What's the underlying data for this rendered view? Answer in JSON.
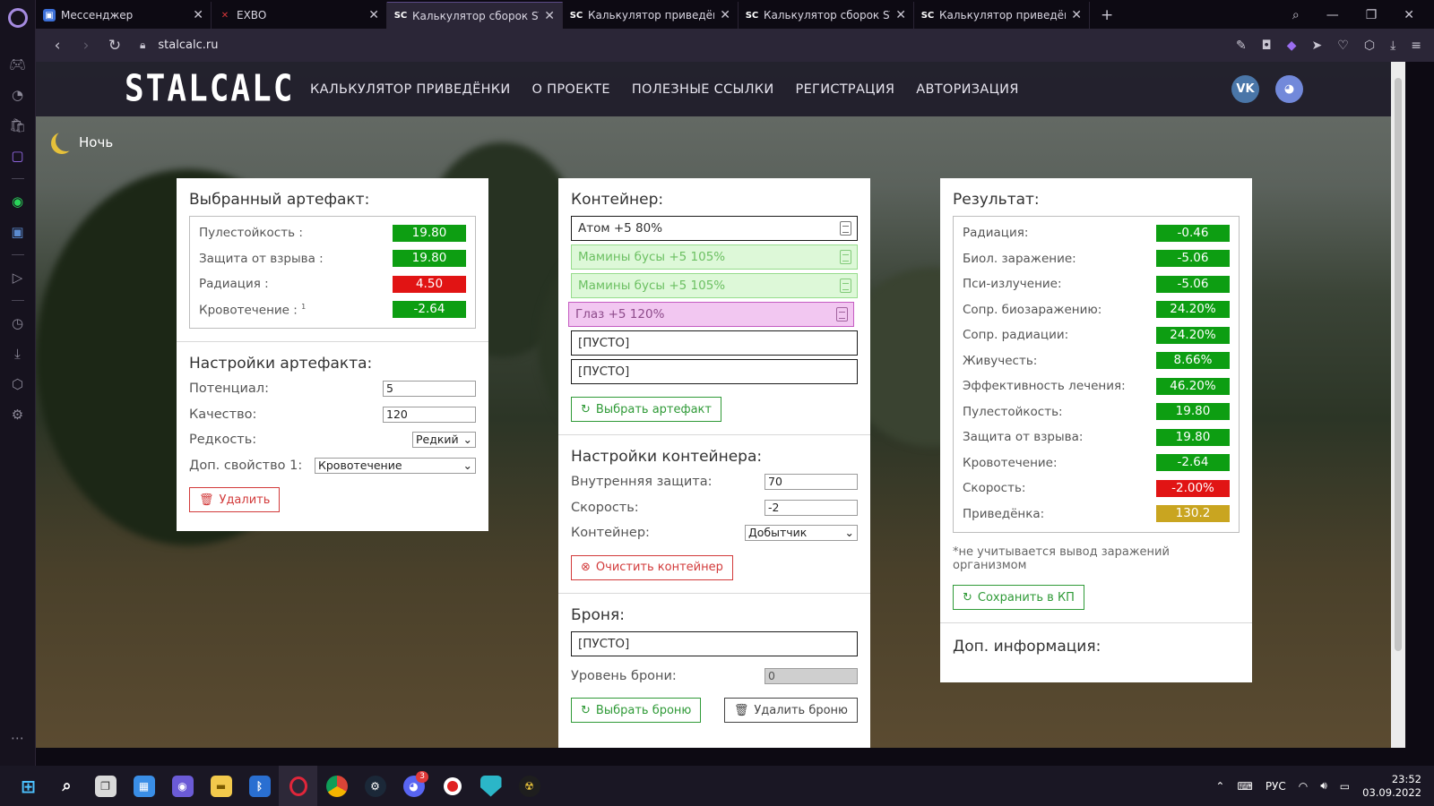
{
  "tabs": [
    {
      "title": "Мессенджер",
      "fav_color": "#3b6fd8",
      "fav_text": "▣"
    },
    {
      "title": "EXBO",
      "fav_color": "#d9373a",
      "fav_text": "✕"
    },
    {
      "title": "Калькулятор сборок STALCALC",
      "fav_color": "#ffffff",
      "fav_text": "SC",
      "active": true
    },
    {
      "title": "Калькулятор приведённости",
      "fav_color": "#ffffff",
      "fav_text": "SC"
    },
    {
      "title": "Калькулятор сборок STALCALC",
      "fav_color": "#ffffff",
      "fav_text": "SC"
    },
    {
      "title": "Калькулятор приведённости",
      "fav_color": "#ffffff",
      "fav_text": "SC"
    }
  ],
  "browser": {
    "url": "stalcalc.ru"
  },
  "site": {
    "logo": "STALCALC",
    "nav": [
      "КАЛЬКУЛЯТОР ПРИВЕДЁНКИ",
      "О ПРОЕКТЕ",
      "ПОЛЕЗНЫЕ ССЫЛКИ",
      "РЕГИСТРАЦИЯ",
      "АВТОРИЗАЦИЯ"
    ],
    "social": [
      {
        "name": "vk-icon",
        "text": "VK",
        "color": "#4a76a8"
      },
      {
        "name": "discord-icon",
        "text": "◕",
        "color": "#7289da"
      }
    ],
    "night_label": "Ночь"
  },
  "artifact_panel": {
    "title": "Выбранный артефакт:",
    "stats": [
      {
        "label": "Пулестойкость :",
        "value": "19.80",
        "color": "g"
      },
      {
        "label": "Защита от взрыва :",
        "value": "19.80",
        "color": "g"
      },
      {
        "label": "Радиация :",
        "value": "4.50",
        "color": "r"
      },
      {
        "label": "Кровотечение :",
        "sup": "1",
        "value": "-2.64",
        "color": "g"
      }
    ],
    "settings_title": "Настройки артефакта:",
    "potential_label": "Потенциал:",
    "potential_value": "5",
    "quality_label": "Качество:",
    "quality_value": "120",
    "rarity_label": "Редкость:",
    "rarity_value": "Редкий",
    "extra_label": "Доп. свойство 1:",
    "extra_value": "Кровотечение",
    "delete_label": "Удалить"
  },
  "container_panel": {
    "title": "Контейнер:",
    "slots": [
      {
        "text": "Атом +5 80%",
        "style": "plain"
      },
      {
        "text": "Мамины бусы +5 105%",
        "style": "green"
      },
      {
        "text": "Мамины бусы +5 105%",
        "style": "green"
      },
      {
        "text": "Глаз +5 120%",
        "style": "pink"
      },
      {
        "text": "[ПУСТО]",
        "style": "plain"
      },
      {
        "text": "[ПУСТО]",
        "style": "plain"
      }
    ],
    "select_artifact_label": "Выбрать артефакт",
    "settings_title": "Настройки контейнера:",
    "inner_protection_label": "Внутренняя защита:",
    "inner_protection_value": "70",
    "speed_label": "Скорость:",
    "speed_value": "-2",
    "container_label": "Контейнер:",
    "container_value": "Добытчик",
    "clear_label": "Очистить контейнер",
    "armor_title": "Броня:",
    "armor_slot": "[ПУСТО]",
    "armor_level_label": "Уровень брони:",
    "armor_level_value": "0",
    "select_armor_label": "Выбрать броню",
    "delete_armor_label": "Удалить броню"
  },
  "result_panel": {
    "title": "Результат:",
    "stats": [
      {
        "label": "Радиация:",
        "value": "-0.46",
        "color": "g"
      },
      {
        "label": "Биол. заражение:",
        "value": "-5.06",
        "color": "g"
      },
      {
        "label": "Пси-излучение:",
        "value": "-5.06",
        "color": "g"
      },
      {
        "label": "Сопр. биозаражению:",
        "value": "24.20%",
        "color": "g"
      },
      {
        "label": "Сопр. радиации:",
        "value": "24.20%",
        "color": "g"
      },
      {
        "label": "Живучесть:",
        "value": "8.66%",
        "color": "g"
      },
      {
        "label": "Эффективность лечения:",
        "value": "46.20%",
        "color": "g"
      },
      {
        "label": "Пулестойкость:",
        "value": "19.80",
        "color": "g"
      },
      {
        "label": "Защита от взрыва:",
        "value": "19.80",
        "color": "g"
      },
      {
        "label": "Кровотечение:",
        "value": "-2.64",
        "color": "g"
      },
      {
        "label": "Скорость:",
        "value": "-2.00%",
        "color": "r"
      },
      {
        "label": "Приведёнка:",
        "value": "130.2",
        "color": "y"
      }
    ],
    "note": "*не учитывается вывод заражений организмом",
    "save_label": "Сохранить в КП",
    "extra_title": "Доп. информация:"
  },
  "taskbar": {
    "lang": "РУС",
    "time": "23:52",
    "date": "03.09.2022",
    "discord_badge": "3"
  }
}
